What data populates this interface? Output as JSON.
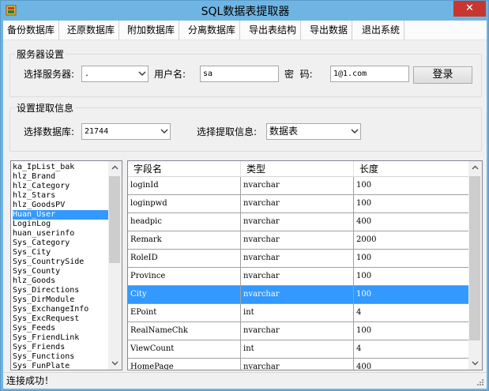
{
  "window": {
    "title": "SQL数据表提取器",
    "close_glyph": "✕"
  },
  "menu": [
    "备份数据库",
    "还原数据库",
    "附加数据库",
    "分离数据库",
    "导出表结构",
    "导出数据",
    "退出系统"
  ],
  "server": {
    "group_label": "服务器设置",
    "server_label": "选择服务器:",
    "server_value": ".",
    "user_label": "用户名:",
    "user_value": "sa",
    "password_label": "密  码:",
    "password_value": "1@1.com",
    "login_button": "登录"
  },
  "extract": {
    "group_label": "设置提取信息",
    "database_label": "选择数据库:",
    "database_value": "21744",
    "info_label": "选择提取信息:",
    "info_value": "数据表"
  },
  "tables": {
    "items": [
      "ka_IpList_bak",
      "hlz_Brand",
      "hlz_Category",
      "hlz_Stars",
      "hlz_GoodsPV",
      "Huan_User",
      "LoginLog",
      "huan_userinfo",
      "Sys_Category",
      "Sys_City",
      "Sys_CountrySide",
      "Sys_County",
      "hlz_Goods",
      "Sys_Directions",
      "Sys_DirModule",
      "Sys_ExchangeInfo",
      "Sys_ExcRequest",
      "Sys_Feeds",
      "Sys_FriendLink",
      "Sys_Friends",
      "Sys_Functions",
      "Sys_FunPlate"
    ],
    "selected": "Huan_User"
  },
  "grid": {
    "headers": [
      "字段名",
      "类型",
      "长度"
    ],
    "rows": [
      [
        "loginId",
        "nvarchar",
        "100"
      ],
      [
        "loginpwd",
        "nvarchar",
        "100"
      ],
      [
        "headpic",
        "nvarchar",
        "400"
      ],
      [
        "Remark",
        "nvarchar",
        "2000"
      ],
      [
        "RoleID",
        "nvarchar",
        "100"
      ],
      [
        "Province",
        "nvarchar",
        "100"
      ],
      [
        "City",
        "nvarchar",
        "100"
      ],
      [
        "EPoint",
        "int",
        "4"
      ],
      [
        "RealNameChk",
        "nvarchar",
        "100"
      ],
      [
        "ViewCount",
        "int",
        "4"
      ],
      [
        "HomePage",
        "nvarchar",
        "400"
      ]
    ],
    "selected_row": "City"
  },
  "status": {
    "text": "连接成功！"
  },
  "colors": {
    "titlebar": "#6fb5e3",
    "close": "#c7372f",
    "selection": "#3399ff"
  },
  "icons": [
    "app-icon",
    "close-icon",
    "dropdown-arrow-icon",
    "scroll-up-icon",
    "scroll-down-icon",
    "resize-grip-icon"
  ]
}
